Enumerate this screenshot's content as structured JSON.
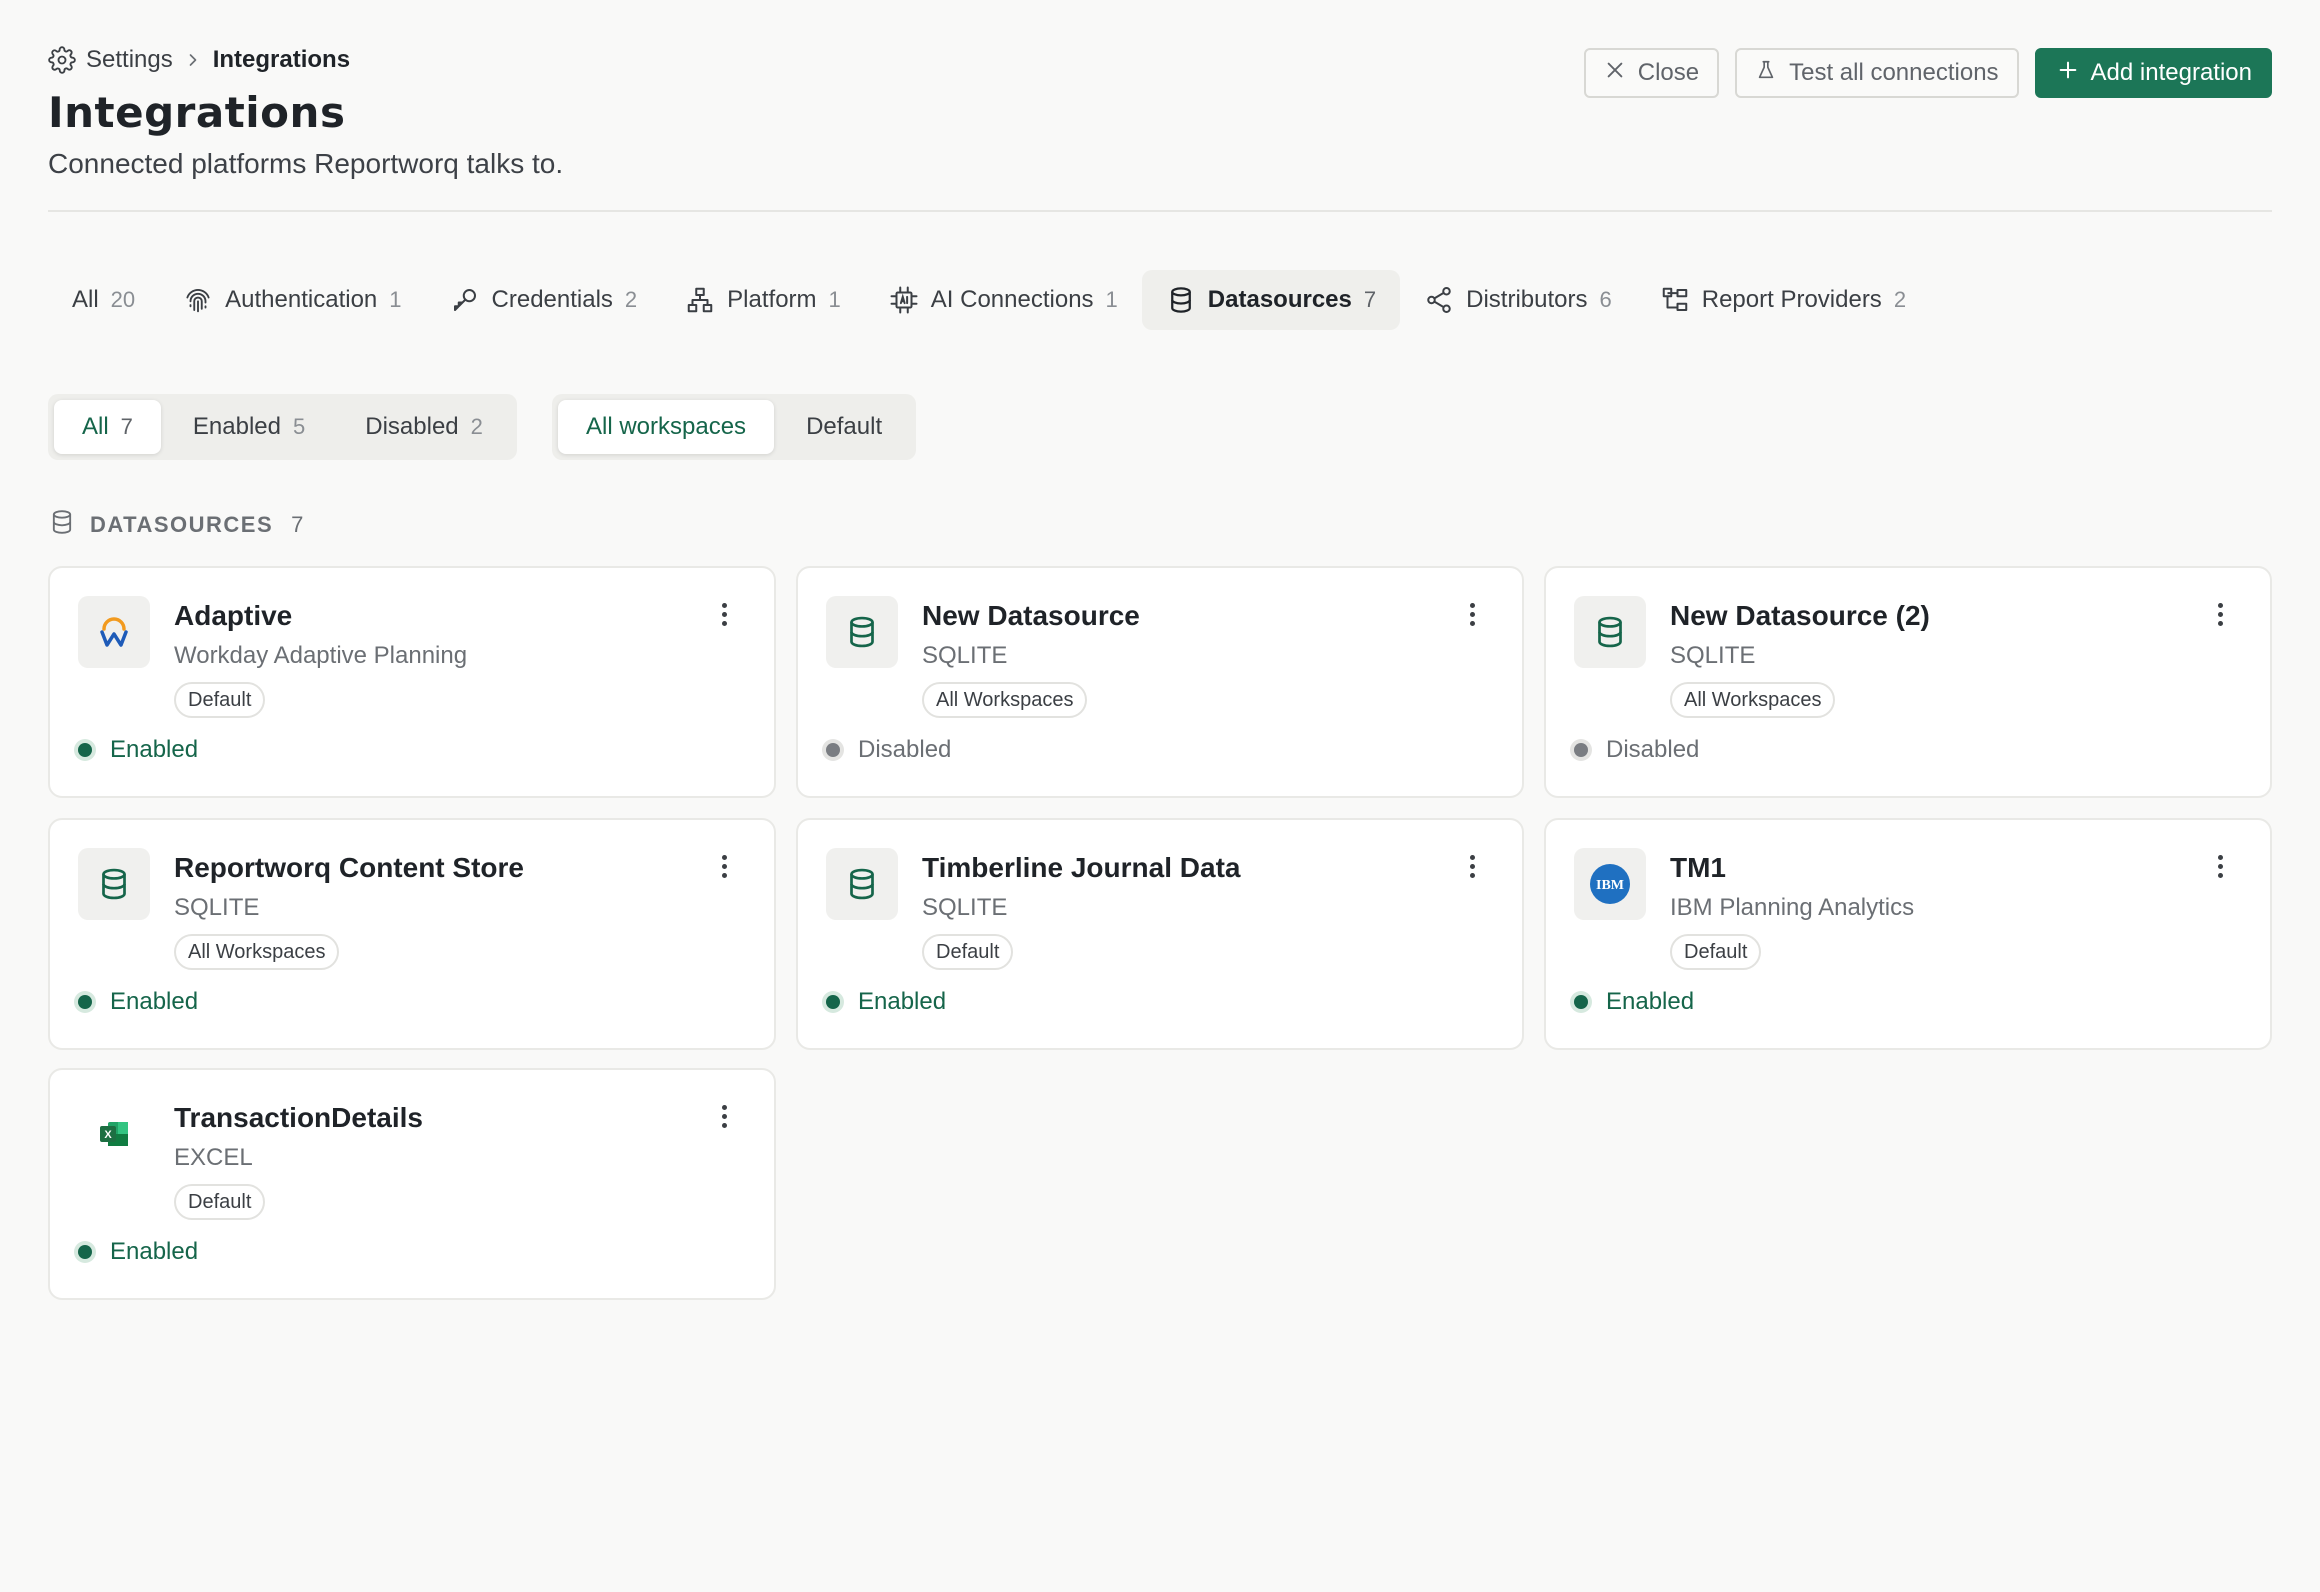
{
  "breadcrumb": {
    "parent": "Settings",
    "current": "Integrations"
  },
  "header": {
    "title": "Integrations",
    "subtitle": "Connected platforms Reportworq talks to."
  },
  "actions": {
    "close": "Close",
    "test_all": "Test all connections",
    "add": "Add integration"
  },
  "category_tabs": [
    {
      "label": "All",
      "count": "20",
      "icon": "none"
    },
    {
      "label": "Authentication",
      "count": "1",
      "icon": "fingerprint-icon"
    },
    {
      "label": "Credentials",
      "count": "2",
      "icon": "key-icon"
    },
    {
      "label": "Platform",
      "count": "1",
      "icon": "network-icon"
    },
    {
      "label": "AI Connections",
      "count": "1",
      "icon": "chip-icon"
    },
    {
      "label": "Datasources",
      "count": "7",
      "icon": "database-icon",
      "active": true
    },
    {
      "label": "Distributors",
      "count": "6",
      "icon": "share-icon"
    },
    {
      "label": "Report Providers",
      "count": "2",
      "icon": "tree-icon"
    }
  ],
  "status_filter": [
    {
      "label": "All",
      "count": "7",
      "active": true
    },
    {
      "label": "Enabled",
      "count": "5"
    },
    {
      "label": "Disabled",
      "count": "2"
    }
  ],
  "workspace_filter": [
    {
      "label": "All workspaces",
      "active": true
    },
    {
      "label": "Default"
    }
  ],
  "section": {
    "title": "DATASOURCES",
    "count": "7"
  },
  "cards": [
    {
      "name": "Adaptive",
      "type": "Workday Adaptive Planning",
      "scope": "Default",
      "status": "Enabled",
      "icon": "workday-logo-icon"
    },
    {
      "name": "New Datasource",
      "type": "SQLITE",
      "scope": "All Workspaces",
      "status": "Disabled",
      "icon": "database-icon"
    },
    {
      "name": "New Datasource (2)",
      "type": "SQLITE",
      "scope": "All Workspaces",
      "status": "Disabled",
      "icon": "database-icon"
    },
    {
      "name": "Reportworq Content Store",
      "type": "SQLITE",
      "scope": "All Workspaces",
      "status": "Enabled",
      "icon": "database-icon"
    },
    {
      "name": "Timberline Journal Data",
      "type": "SQLITE",
      "scope": "Default",
      "status": "Enabled",
      "icon": "database-icon"
    },
    {
      "name": "TM1",
      "type": "IBM Planning Analytics",
      "scope": "Default",
      "status": "Enabled",
      "icon": "ibm-logo-icon",
      "logo_text": "IBM"
    },
    {
      "name": "TransactionDetails",
      "type": "EXCEL",
      "scope": "Default",
      "status": "Enabled",
      "icon": "excel-icon",
      "logo_text": "X"
    }
  ],
  "colors": {
    "accent": "#1c7657",
    "enabled": "#15654a",
    "disabled": "#7a7d82",
    "ibm_blue": "#1f70c1",
    "excel_green": "#1d6f42"
  }
}
